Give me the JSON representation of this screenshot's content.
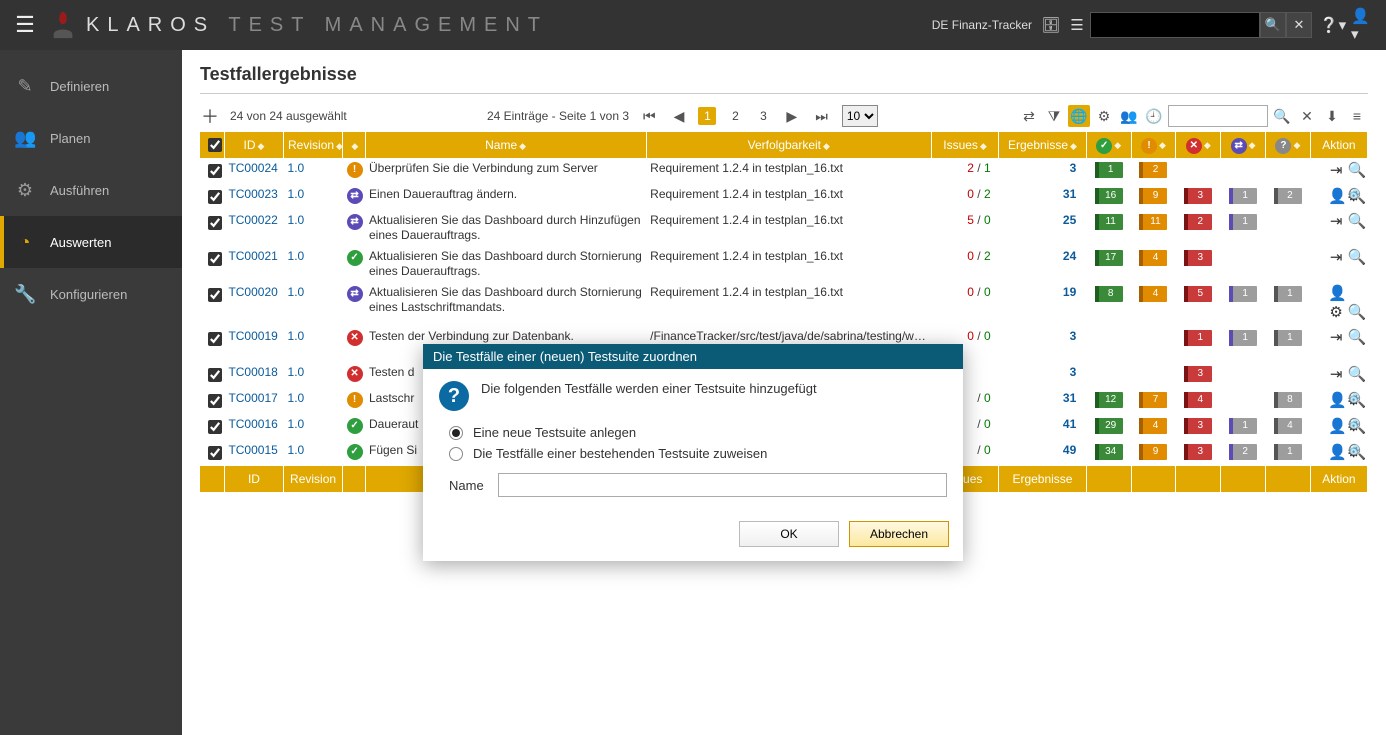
{
  "brand": {
    "name": "KLAROS",
    "suffix": "TEST MANAGEMENT"
  },
  "project": "DE Finanz-Tracker",
  "sidebar": [
    {
      "label": "Definieren",
      "glyph": "✎"
    },
    {
      "label": "Planen",
      "glyph": "👥"
    },
    {
      "label": "Ausführen",
      "glyph": "⚙"
    },
    {
      "label": "Auswerten",
      "glyph": "◔"
    },
    {
      "label": "Konfigurieren",
      "glyph": "🔧"
    }
  ],
  "page": {
    "title": "Testfallergebnisse"
  },
  "toolbar": {
    "selection": "24 von 24 ausgewählt",
    "entries": "24 Einträge - Seite 1 von 3",
    "pages": [
      "1",
      "2",
      "3"
    ],
    "currentPage": "1",
    "pageSize": "10"
  },
  "columns": {
    "id": "ID",
    "rev": "Revision",
    "name": "Name",
    "trace": "Verfolgbarkeit",
    "issues": "Issues",
    "results": "Ergebnisse",
    "action": "Aktion"
  },
  "rows": [
    {
      "id": "TC00024",
      "rev": "1.0",
      "status": "warn",
      "name": "Überprüfen Sie die Verbindung zum Server",
      "trace": "Requirement 1.2.4 in testplan_16.txt",
      "issA": "2",
      "issB": "1",
      "results": "3",
      "pass": "1",
      "warn": "2",
      "fail": "",
      "run": "",
      "unk": "",
      "act": "assign"
    },
    {
      "id": "TC00023",
      "rev": "1.0",
      "status": "run",
      "name": "Einen Dauerauftrag ändern.",
      "trace": "Requirement 1.2.4 in testplan_16.txt",
      "issA": "0",
      "issB": "2",
      "results": "31",
      "pass": "16",
      "warn": "9",
      "fail": "3",
      "run": "1",
      "unk": "2",
      "act": "user"
    },
    {
      "id": "TC00022",
      "rev": "1.0",
      "status": "run",
      "name": "Aktualisieren Sie das Dashboard durch Hinzufügen eines Dauerauftrags.",
      "trace": "Requirement 1.2.4 in testplan_16.txt",
      "issA": "5",
      "issB": "0",
      "results": "25",
      "pass": "11",
      "warn": "11",
      "fail": "2",
      "run": "1",
      "unk": "",
      "act": "assign",
      "tall": true
    },
    {
      "id": "TC00021",
      "rev": "1.0",
      "status": "ok",
      "name": "Aktualisieren Sie das Dashboard durch Stornierung eines Dauerauftrags.",
      "trace": "Requirement 1.2.4 in testplan_16.txt",
      "issA": "0",
      "issB": "2",
      "results": "24",
      "pass": "17",
      "warn": "4",
      "fail": "3",
      "run": "",
      "unk": "",
      "act": "assign",
      "tall": true
    },
    {
      "id": "TC00020",
      "rev": "1.0",
      "status": "run",
      "name": "Aktualisieren Sie das Dashboard durch Stornierung eines Lastschriftmandats.",
      "trace": "Requirement 1.2.4 in testplan_16.txt",
      "issA": "0",
      "issB": "0",
      "results": "19",
      "pass": "8",
      "warn": "4",
      "fail": "5",
      "run": "1",
      "unk": "1",
      "act": "user",
      "tall": true
    },
    {
      "id": "TC00019",
      "rev": "1.0",
      "status": "err",
      "name": "Testen der Verbindung zur Datenbank.",
      "trace": "/FinanceTracker/src/test/java/de/sabrina/testing/web/Connection.java",
      "issA": "0",
      "issB": "0",
      "results": "3",
      "pass": "",
      "warn": "",
      "fail": "1",
      "run": "1",
      "unk": "1",
      "act": "assign",
      "tall": true
    },
    {
      "id": "TC00018",
      "rev": "1.0",
      "status": "err",
      "name": "Testen d",
      "trace": "",
      "issA": "",
      "issB": "",
      "results": "3",
      "pass": "",
      "warn": "",
      "fail": "3",
      "run": "",
      "unk": "",
      "act": "assign"
    },
    {
      "id": "TC00017",
      "rev": "1.0",
      "status": "warn",
      "name": "Lastschr",
      "trace": "",
      "issA": "",
      "issB": "0",
      "results": "31",
      "pass": "12",
      "warn": "7",
      "fail": "4",
      "run": "",
      "unk": "8",
      "act": "user"
    },
    {
      "id": "TC00016",
      "rev": "1.0",
      "status": "ok",
      "name": "Daueraut",
      "trace": "",
      "issA": "",
      "issB": "0",
      "results": "41",
      "pass": "29",
      "warn": "4",
      "fail": "3",
      "run": "1",
      "unk": "4",
      "act": "user"
    },
    {
      "id": "TC00015",
      "rev": "1.0",
      "status": "ok",
      "name": "Fügen Si",
      "trace": "",
      "issA": "",
      "issB": "0",
      "results": "49",
      "pass": "34",
      "warn": "9",
      "fail": "3",
      "run": "2",
      "unk": "1",
      "act": "user"
    }
  ],
  "modal": {
    "title": "Die Testfälle einer (neuen) Testsuite zuordnen",
    "message": "Die folgenden Testfälle werden einer Testsuite hinzugefügt",
    "optNew": "Eine neue Testsuite anlegen",
    "optExist": "Die Testfälle einer bestehenden Testsuite zuweisen",
    "nameLabel": "Name",
    "ok": "OK",
    "cancel": "Abbrechen"
  }
}
